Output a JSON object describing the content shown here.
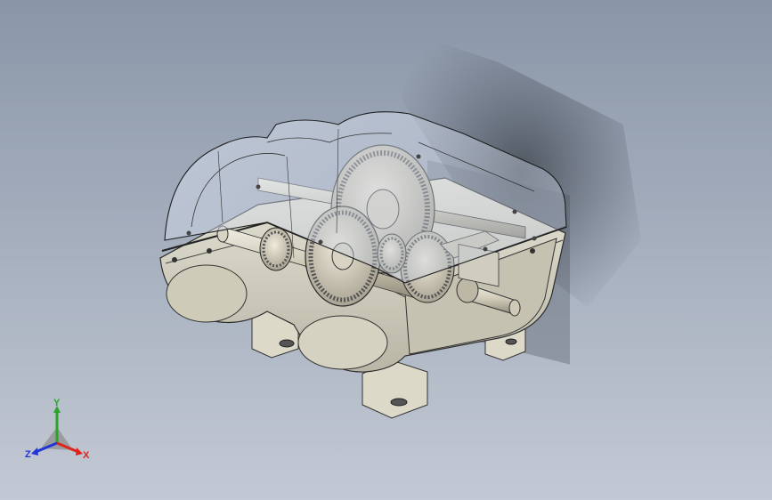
{
  "viewport": {
    "model": "gearbox-assembly",
    "display_mode": "shaded-with-edges",
    "background_top": "#8a96a8",
    "background_bottom": "#c3c9d4"
  },
  "triad": {
    "x_label": "X",
    "y_label": "Y",
    "z_label": "Z",
    "x_color": "#e0241b",
    "y_color": "#2aa52a",
    "z_color": "#2136d8"
  }
}
